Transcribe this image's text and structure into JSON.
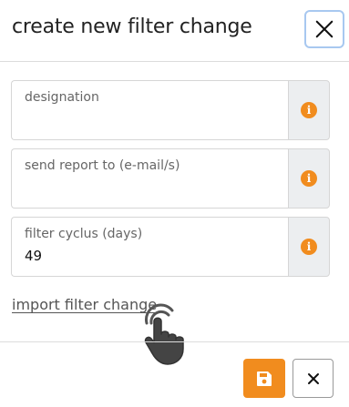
{
  "dialog": {
    "title": "create new filter change",
    "close_icon": "close-icon"
  },
  "fields": [
    {
      "label": "designation",
      "value": "",
      "info_icon": "info-icon"
    },
    {
      "label": "send report to (e-mail/s)",
      "value": "",
      "info_icon": "info-icon"
    },
    {
      "label": "filter cyclus (days)",
      "value": "49",
      "info_icon": "info-icon"
    }
  ],
  "import_link": {
    "label": "import filter change"
  },
  "footer": {
    "save_icon": "floppy-disk-icon",
    "cancel_icon": "close-icon"
  },
  "colors": {
    "accent": "#f18c1e",
    "focus_border": "#a8c8f0",
    "addon_bg": "#eceef0"
  }
}
